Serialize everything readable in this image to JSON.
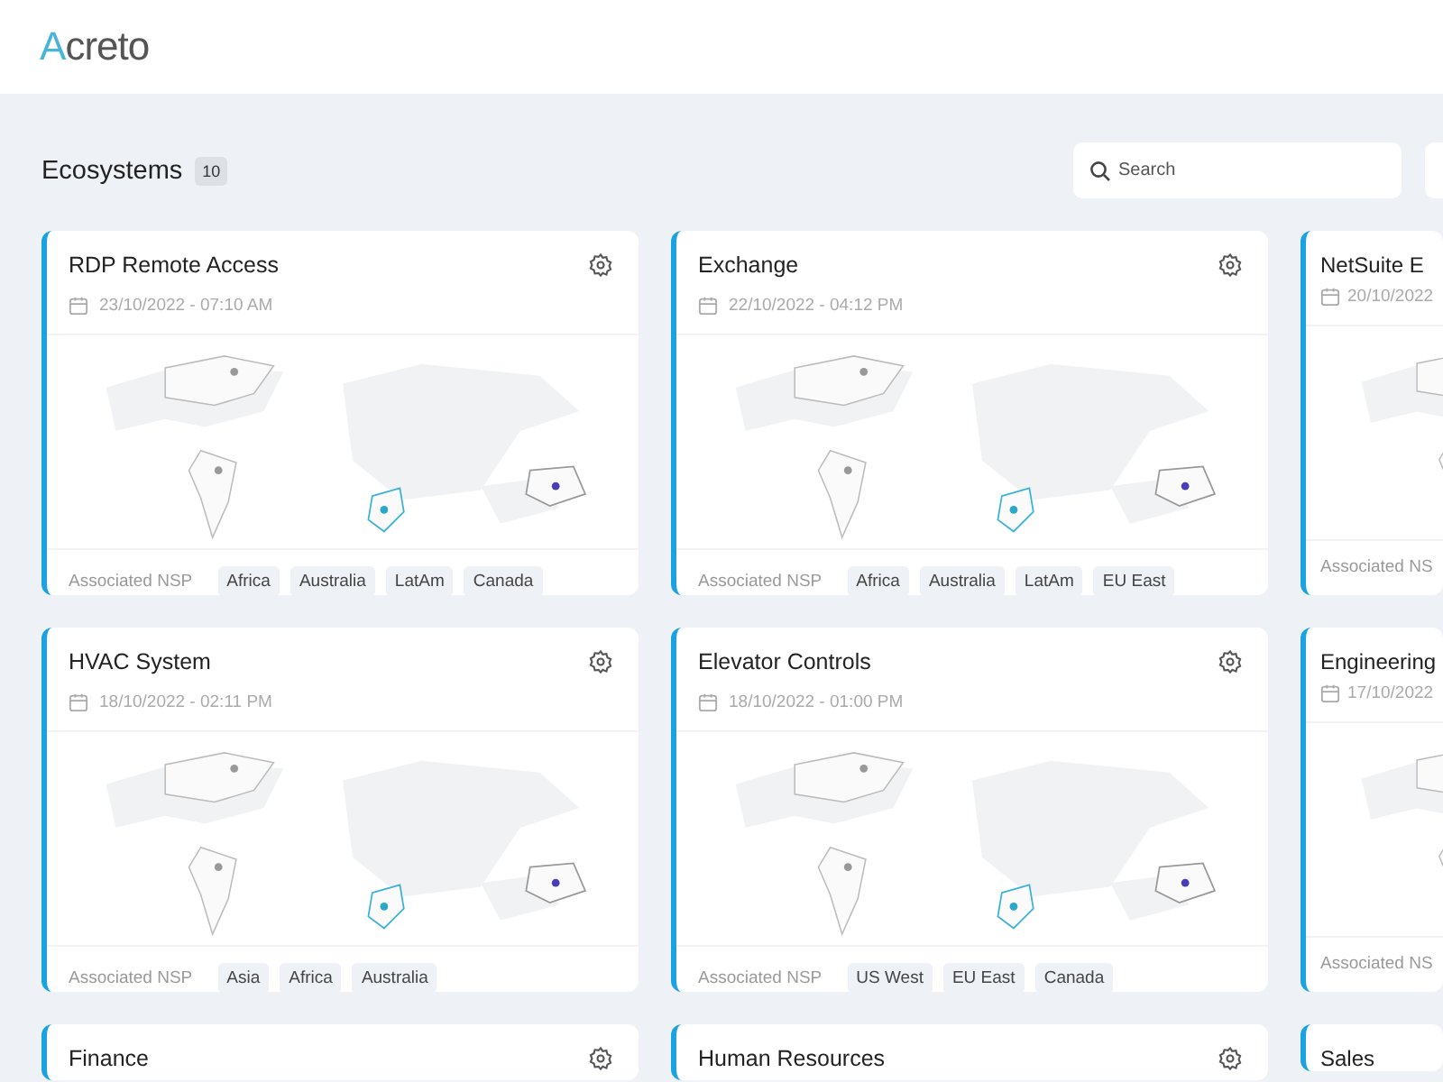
{
  "header": {
    "logo": "Acreto"
  },
  "page": {
    "title": "Ecosystems",
    "count": "10",
    "search": {
      "placeholder": "Search"
    }
  },
  "cards": [
    {
      "title": "RDP Remote Access",
      "date": "23/10/2022 - 07:10 AM",
      "nsp_label": "Associated NSP",
      "tags": [
        "Africa",
        "Australia",
        "LatAm",
        "Canada"
      ]
    },
    {
      "title": "Exchange",
      "date": "22/10/2022 - 04:12 PM",
      "nsp_label": "Associated NSP",
      "tags": [
        "Africa",
        "Australia",
        "LatAm",
        "EU East"
      ]
    },
    {
      "title": "NetSuite E",
      "date": "20/10/2022",
      "nsp_label": "Associated NS"
    },
    {
      "title": "HVAC System",
      "date": "18/10/2022 - 02:11 PM",
      "nsp_label": "Associated NSP",
      "tags": [
        "Asia",
        "Africa",
        "Australia"
      ]
    },
    {
      "title": "Elevator Controls",
      "date": "18/10/2022 - 01:00 PM",
      "nsp_label": "Associated NSP",
      "tags": [
        "US West",
        "EU East",
        "Canada"
      ]
    },
    {
      "title": "Engineering",
      "date": "17/10/2022",
      "nsp_label": "Associated NS"
    },
    {
      "title": "Finance"
    },
    {
      "title": "Human Resources"
    },
    {
      "title": "Sales"
    }
  ]
}
